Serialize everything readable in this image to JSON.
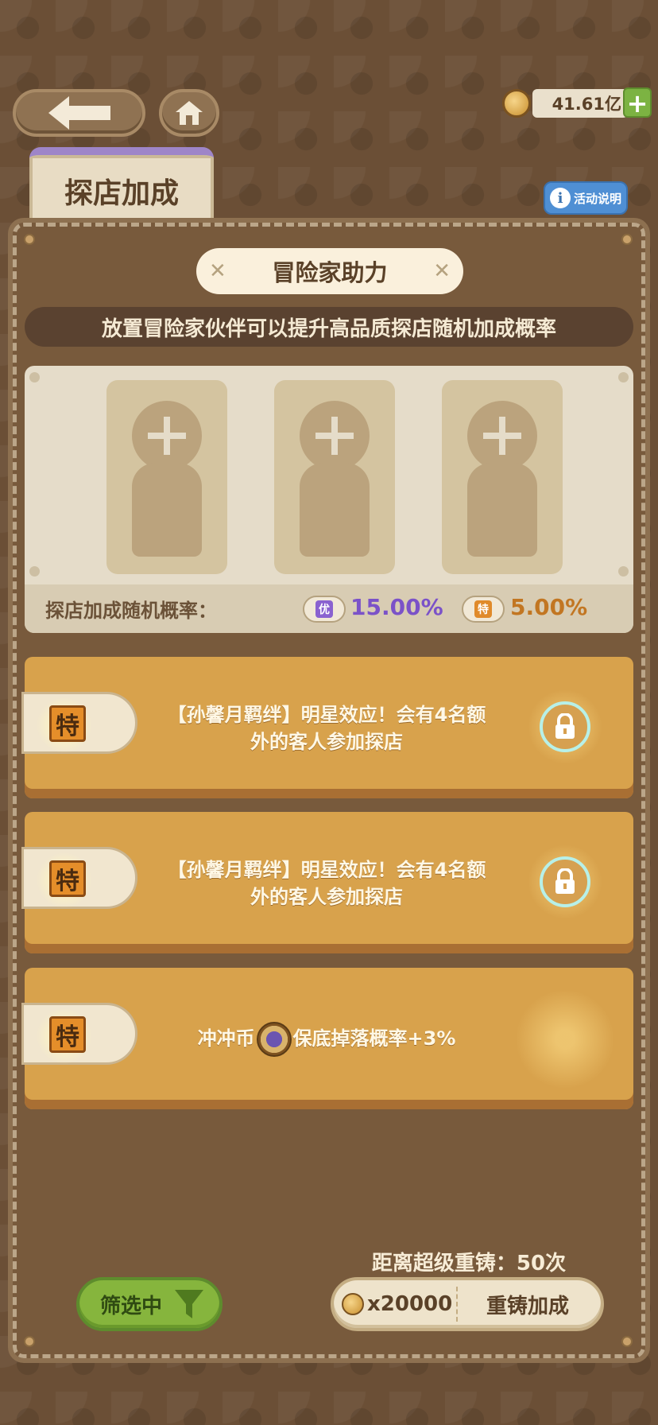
{
  "header": {
    "back_icon": "arrow-left-icon",
    "home_icon": "home-icon",
    "currency": {
      "amount": "41.61亿",
      "plus_label": "+"
    }
  },
  "tab": {
    "label": "探店加成"
  },
  "help": {
    "label": "活动说明",
    "icon_glyph": "i"
  },
  "panel": {
    "subtitle": "冒险家助力",
    "description": "放置冒险家伙伴可以提升高品质探店随机加成概率",
    "slots": [
      {
        "state": "empty"
      },
      {
        "state": "empty"
      },
      {
        "state": "empty"
      }
    ],
    "rate_label": "探店加成随机概率：",
    "rates": [
      {
        "tier": "优",
        "value": "15.00%",
        "color": "#7b52c8"
      },
      {
        "tier": "特",
        "value": "5.00%",
        "color": "#c27622"
      }
    ]
  },
  "bonuses": [
    {
      "tier": "特",
      "line1": "【孙馨月羁绊】明星效应！会有4名额",
      "line2": "外的客人参加探店",
      "locked": true
    },
    {
      "tier": "特",
      "line1": "【孙馨月羁绊】明星效应！会有4名额",
      "line2": "外的客人参加探店",
      "locked": true
    },
    {
      "tier": "特",
      "text_before": "冲冲币",
      "text_after": "保底掉落概率+3%",
      "locked": false
    }
  ],
  "footer": {
    "reforge_count": "距离超级重铸：50次",
    "filter_label": "筛选中",
    "cost": "x20000",
    "reforge_label": "重铸加成"
  }
}
